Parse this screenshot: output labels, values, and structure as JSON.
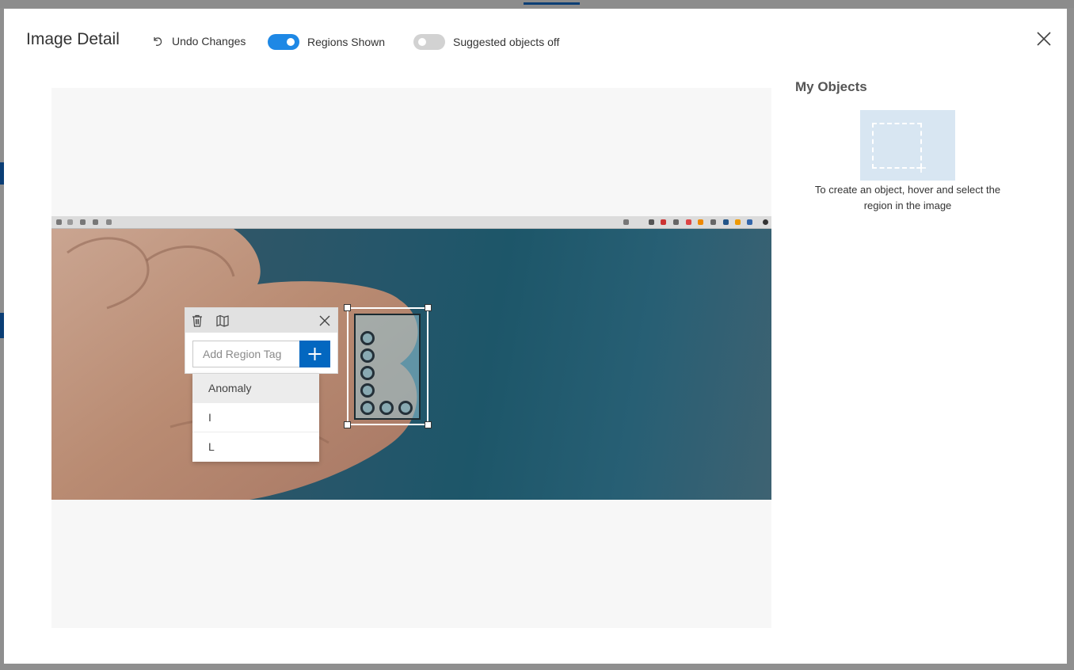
{
  "header": {
    "title": "Image Detail",
    "undo_label": "Undo Changes",
    "regions_toggle": {
      "label": "Regions Shown",
      "on": true
    },
    "suggested_toggle": {
      "label": "Suggested objects off",
      "on": false
    }
  },
  "colors": {
    "accent": "#1e88e5",
    "add_button": "#0367c0",
    "card_bg": "#d8e6f2"
  },
  "region_tag": {
    "placeholder": "Add Region Tag",
    "options": [
      {
        "label": "Anomaly",
        "highlighted": true
      },
      {
        "label": "I",
        "highlighted": false
      },
      {
        "label": "L",
        "highlighted": false
      }
    ]
  },
  "my_objects": {
    "title": "My Objects",
    "hint": "To create an object, hover and select the region in the image"
  },
  "icons": {
    "undo": "undo-icon",
    "close": "close-icon",
    "delete": "trash-icon",
    "map": "map-icon",
    "add": "plus-icon"
  }
}
